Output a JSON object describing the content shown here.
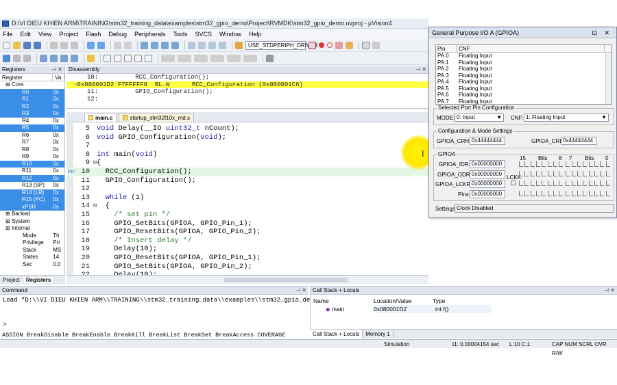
{
  "window": {
    "title": "D:\\VI DIEU KHIEN ARM\\TRAINING\\stm32_training_data\\examples\\stm32_gpio_demo\\Project\\RVMDK\\stm32_gpio_demo.uvproj - µVision4"
  },
  "menu": [
    "File",
    "Edit",
    "View",
    "Project",
    "Flash",
    "Debug",
    "Peripherals",
    "Tools",
    "SVCS",
    "Window",
    "Help"
  ],
  "toolbar": {
    "target_combo": "USE_STDPERIPH_DRIVER"
  },
  "registers": {
    "title": "Registers",
    "col_register": "Register",
    "col_value": "Va",
    "rows": [
      {
        "name": "Core",
        "value": "",
        "type": "group"
      },
      {
        "name": "R0",
        "value": "0x",
        "sel": true
      },
      {
        "name": "R1",
        "value": "0x",
        "sel": true
      },
      {
        "name": "R2",
        "value": "0x",
        "sel": true
      },
      {
        "name": "R3",
        "value": "0x",
        "sel": true
      },
      {
        "name": "R4",
        "value": "0x",
        "sel": false
      },
      {
        "name": "R5",
        "value": "0x",
        "sel": true
      },
      {
        "name": "R6",
        "value": "0x",
        "sel": false
      },
      {
        "name": "R7",
        "value": "0x",
        "sel": false
      },
      {
        "name": "R8",
        "value": "0x",
        "sel": false
      },
      {
        "name": "R9",
        "value": "0x",
        "sel": false
      },
      {
        "name": "R10",
        "value": "0x",
        "sel": true
      },
      {
        "name": "R11",
        "value": "0x",
        "sel": false
      },
      {
        "name": "R12",
        "value": "0x",
        "sel": true
      },
      {
        "name": "R13 (SP)",
        "value": "0x",
        "sel": false
      },
      {
        "name": "R14 (LR)",
        "value": "0x",
        "sel": true
      },
      {
        "name": "R15 (PC)",
        "value": "0x",
        "sel": true
      },
      {
        "name": "xPSR",
        "value": "0x",
        "sel": true
      },
      {
        "name": "Banked",
        "value": "",
        "type": "group"
      },
      {
        "name": "System",
        "value": "",
        "type": "group"
      },
      {
        "name": "Internal",
        "value": "",
        "type": "group"
      },
      {
        "name": "Mode",
        "value": "Th",
        "type": "sub"
      },
      {
        "name": "Privilege",
        "value": "Pri",
        "type": "sub"
      },
      {
        "name": "Stack",
        "value": "MS",
        "type": "sub"
      },
      {
        "name": "States",
        "value": "14",
        "type": "sub"
      },
      {
        "name": "Sec",
        "value": "0.0",
        "type": "sub"
      }
    ],
    "tabs": [
      "Project",
      "Registers"
    ]
  },
  "disassembly": {
    "title": "Disassembly",
    "lines": [
      {
        "text": "10:          RCC_Configuration();",
        "hl": false
      },
      {
        "text": "0x080001D2 F7FFFFF8  BL.W      RCC_Configuration (0x080001C6)",
        "hl": true
      },
      {
        "text": "11:          GPIO_Configuration();",
        "hl": false
      },
      {
        "text": "12:",
        "hl": false
      }
    ]
  },
  "editor": {
    "tabs": [
      {
        "label": "main.c",
        "active": true
      },
      {
        "label": "startup_stm32f10x_md.s",
        "active": false
      }
    ],
    "lines": [
      {
        "n": "5",
        "fold": "",
        "code": "void Delay(__IO uint32_t nCount);"
      },
      {
        "n": "6",
        "fold": "",
        "code": "void GPIO_Configuration(void);"
      },
      {
        "n": "7",
        "fold": "",
        "code": ""
      },
      {
        "n": "8",
        "fold": "",
        "code": "int main(void)"
      },
      {
        "n": "9",
        "fold": "⊟",
        "code": "{"
      },
      {
        "n": "10",
        "fold": "",
        "code": "  RCC_Configuration();",
        "current": true
      },
      {
        "n": "11",
        "fold": "",
        "code": "  GPIO_Configuration();"
      },
      {
        "n": "12",
        "fold": "",
        "code": ""
      },
      {
        "n": "13",
        "fold": "",
        "code": "  while (1)"
      },
      {
        "n": "14",
        "fold": "⊟",
        "code": "  {"
      },
      {
        "n": "15",
        "fold": "",
        "code": "    /* set pin */"
      },
      {
        "n": "16",
        "fold": "",
        "code": "    GPIO_SetBits(GPIOA, GPIO_Pin_1);"
      },
      {
        "n": "17",
        "fold": "",
        "code": "    GPIO_ResetBits(GPIOA, GPIO_Pin_2);"
      },
      {
        "n": "18",
        "fold": "",
        "code": "    /* Insert delay */"
      },
      {
        "n": "19",
        "fold": "",
        "code": "    Delay(10);"
      },
      {
        "n": "20",
        "fold": "",
        "code": "    GPIO_ResetBits(GPIOA, GPIO_Pin_1);"
      },
      {
        "n": "21",
        "fold": "",
        "code": "    GPIO_SetBits(GPIOA, GPIO_Pin_2);"
      },
      {
        "n": "22",
        "fold": "",
        "code": "    Delay(10);"
      }
    ]
  },
  "command": {
    "title": "Command",
    "text": "Load \"D:\\\\VI DIEU KHIEN ARM\\\\TRAINING\\\\stm32_training_data\\\\examples\\\\stm32_gpio_de",
    "prompt": ">",
    "hints": "ASSIGN BreakDisable BreakEnable BreakKill BreakList BreakSet BreakAccess COVERAGE"
  },
  "callstack": {
    "title": "Call Stack + Locals",
    "headers": [
      "Name",
      "Location/Value",
      "Type"
    ],
    "row": {
      "name": "main",
      "location": "0x080001D2",
      "type": "int f()"
    },
    "tabs": [
      "Call Stack + Locals",
      "Memory 1"
    ]
  },
  "status": {
    "mode": "Simulation",
    "time": "t1: 0.00004154 sec",
    "pos": "L:10 C:1",
    "flags": "CAP  NUM  SCRL  OVR  R/W"
  },
  "gpio": {
    "title": "General Purpose I/O A (GPIOA)",
    "pin_header": [
      "Pin",
      "CNF"
    ],
    "pins": [
      {
        "pin": "PA.0",
        "cnf": "Floating Input"
      },
      {
        "pin": "PA.1",
        "cnf": "Floating Input"
      },
      {
        "pin": "PA.2",
        "cnf": "Floating Input"
      },
      {
        "pin": "PA.3",
        "cnf": "Floating Input"
      },
      {
        "pin": "PA.4",
        "cnf": "Floating Input"
      },
      {
        "pin": "PA.5",
        "cnf": "Floating Input"
      },
      {
        "pin": "PA.6",
        "cnf": "Floating Input"
      },
      {
        "pin": "PA.7",
        "cnf": "Floating Input"
      }
    ],
    "selected_group": "Selected Port Pin Configuration",
    "mode_label": "MODE:",
    "mode_value": "0: Input",
    "cnf_label": "CNF:",
    "cnf_value": "1: Floating Input",
    "config_group": "Configuration & Mode Settings",
    "crh_label": "GPIOA_CRH:",
    "crh_value": "0x44444444",
    "crl_label": "GPIOA_CRL:",
    "crl_value": "0x44444444",
    "gpioa_group": "GPIOA",
    "bits_hdr": {
      "b15": "15",
      "bits1": "Bits",
      "b8": "8",
      "b7": "7",
      "bits2": "Bits",
      "b0": "0"
    },
    "idr_label": "GPIOA_IDR:",
    "idr_value": "0x00000000",
    "odr_label": "GPIOA_ODR:",
    "odr_value": "0x00000000",
    "lckr_label": "GPIOA_LCKR:",
    "lckr_value": "0x00000000",
    "lckk_label": "LCKK",
    "pins_label": "Pins:",
    "pins_value": "0x00000000",
    "settings_label": "Settings:",
    "settings_value": "Clock Disabled"
  }
}
